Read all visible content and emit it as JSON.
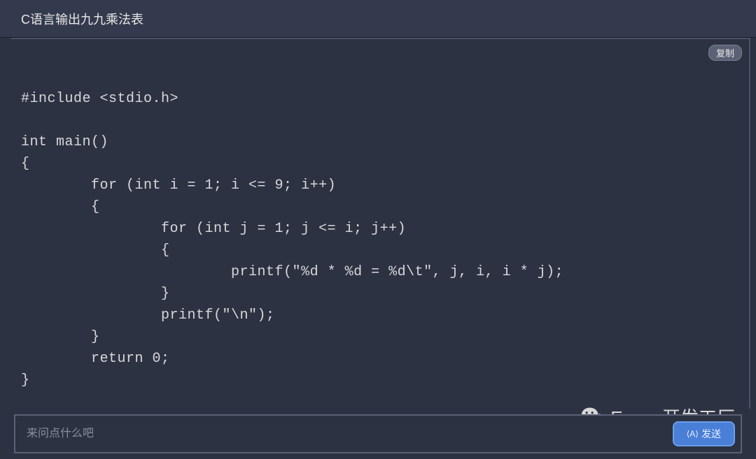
{
  "header": {
    "title": "C语言输出九九乘法表"
  },
  "toolbar": {
    "copy_label": "复制"
  },
  "code": {
    "content": "#include <stdio.h>\n\nint main()\n{\n        for (int i = 1; i <= 9; i++)\n        {\n                for (int j = 1; j <= i; j++)\n                {\n                        printf(\"%d * %d = %d\\t\", j, i, i * j);\n                }\n                printf(\"\\n\");\n        }\n        return 0;\n}"
  },
  "input": {
    "placeholder": "来问点什么吧",
    "send_label": "发送"
  },
  "watermark": {
    "text": "Enovo开发工厂"
  }
}
